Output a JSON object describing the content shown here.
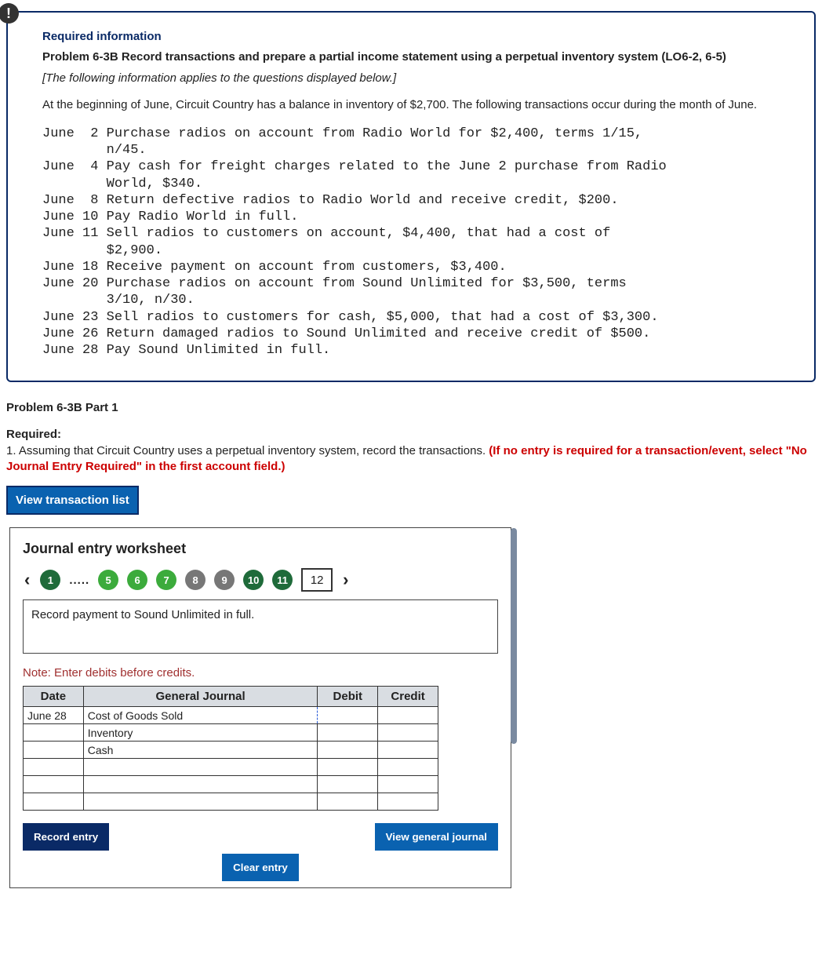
{
  "info": {
    "required_label": "Required information",
    "title": "Problem 6-3B Record transactions and prepare a partial income statement using a perpetual inventory system (LO6-2, 6-5)",
    "applies": "[The following information applies to the questions displayed below.]",
    "intro": "At the beginning of June, Circuit Country has a balance in inventory of $2,700. The following transactions occur during the month of June.",
    "transactions_block": "June  2 Purchase radios on account from Radio World for $2,400, terms 1/15,\n        n/45.\nJune  4 Pay cash for freight charges related to the June 2 purchase from Radio\n        World, $340.\nJune  8 Return defective radios to Radio World and receive credit, $200.\nJune 10 Pay Radio World in full.\nJune 11 Sell radios to customers on account, $4,400, that had a cost of\n        $2,900.\nJune 18 Receive payment on account from customers, $3,400.\nJune 20 Purchase radios on account from Sound Unlimited for $3,500, terms\n        3/10, n/30.\nJune 23 Sell radios to customers for cash, $5,000, that had a cost of $3,300.\nJune 26 Return damaged radios to Sound Unlimited and receive credit of $500.\nJune 28 Pay Sound Unlimited in full."
  },
  "part": {
    "title": "Problem 6-3B Part 1"
  },
  "required": {
    "label": "Required:",
    "text": "1. Assuming that Circuit Country uses a perpetual inventory system, record the transactions. ",
    "hint": "(If no entry is required for a transaction/event, select \"No Journal Entry Required\" in the first account field.)"
  },
  "view_list_btn": "View transaction list",
  "worksheet": {
    "title": "Journal entry worksheet",
    "tabs": [
      "1",
      "5",
      "6",
      "7",
      "8",
      "9",
      "10",
      "11",
      "12"
    ],
    "ellipsis": ".....",
    "prompt": "Record payment to Sound Unlimited in full.",
    "note": "Note: Enter debits before credits.",
    "headers": {
      "date": "Date",
      "gj": "General Journal",
      "debit": "Debit",
      "credit": "Credit"
    },
    "rows": [
      {
        "date": "June 28",
        "gj": "Cost of Goods Sold",
        "debit": "",
        "credit": ""
      },
      {
        "date": "",
        "gj": "Inventory",
        "debit": "",
        "credit": ""
      },
      {
        "date": "",
        "gj": "Cash",
        "debit": "",
        "credit": ""
      },
      {
        "date": "",
        "gj": "",
        "debit": "",
        "credit": ""
      },
      {
        "date": "",
        "gj": "",
        "debit": "",
        "credit": ""
      },
      {
        "date": "",
        "gj": "",
        "debit": "",
        "credit": ""
      }
    ],
    "buttons": {
      "record": "Record entry",
      "clear": "Clear entry",
      "view": "View general journal"
    }
  }
}
